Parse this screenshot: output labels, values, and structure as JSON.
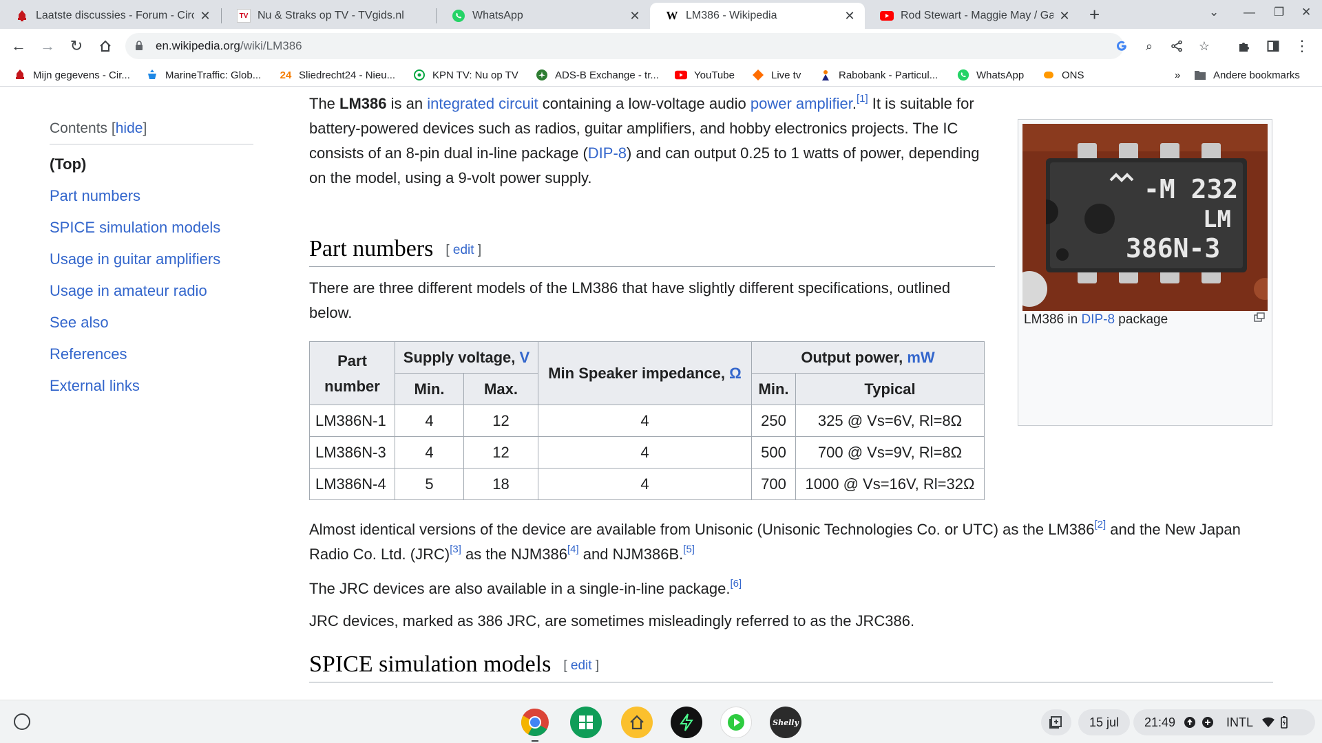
{
  "tabs": [
    {
      "title": "Laatste discussies - Forum - Circ",
      "favicon": "circuits-online-icon"
    },
    {
      "title": "Nu & Straks op TV - TVgids.nl",
      "favicon": "tvgids-icon",
      "favtext": "TV"
    },
    {
      "title": "WhatsApp",
      "favicon": "whatsapp-icon"
    },
    {
      "title": "LM386 - Wikipedia",
      "favicon": "wikipedia-icon",
      "favtext": "W"
    },
    {
      "title": "Rod Stewart - Maggie May / Gasc",
      "favicon": "youtube-icon"
    }
  ],
  "toolbar": {
    "url_host": "en.wikipedia.org",
    "url_path": "/wiki/LM386"
  },
  "bookmarks": [
    {
      "label": "Mijn gegevens - Cir...",
      "icon": "circuits-online-icon"
    },
    {
      "label": "MarineTraffic: Glob...",
      "icon": "marinetraffic-icon"
    },
    {
      "label": "Sliedrecht24 - Nieu...",
      "icon": "sliedrecht24-icon",
      "favtext": "24"
    },
    {
      "label": "KPN TV: Nu op TV",
      "icon": "kpn-icon"
    },
    {
      "label": "ADS-B Exchange - tr...",
      "icon": "adsb-icon"
    },
    {
      "label": "YouTube",
      "icon": "youtube-icon"
    },
    {
      "label": "Live tv",
      "icon": "livetv-icon"
    },
    {
      "label": "Rabobank - Particul...",
      "icon": "rabobank-icon"
    },
    {
      "label": "WhatsApp",
      "icon": "whatsapp-icon"
    },
    {
      "label": "ONS",
      "icon": "ons-icon"
    }
  ],
  "bookmarks_more": "»",
  "other_bookmarks": "Andere bookmarks",
  "toc": {
    "heading": "Contents",
    "hide_open": "[",
    "hide_link": "hide",
    "hide_close": "]",
    "items": [
      "(Top)",
      "Part numbers",
      "SPICE simulation models",
      "Usage in guitar amplifiers",
      "Usage in amateur radio",
      "See also",
      "References",
      "External links"
    ]
  },
  "intro": {
    "t1": "The ",
    "bold": "LM386",
    "t2": " is an ",
    "link1": "integrated circuit",
    "t3": " containing a low-voltage audio ",
    "link2": "power amplifier",
    "t4": ".",
    "ref1": "[1]",
    "t5": " It is suitable for battery-powered devices such as radios, guitar amplifiers, and hobby electronics projects. The IC consists of an 8-pin dual in-line package (",
    "link3": "DIP-8",
    "t6": ") and can output 0.25 to 1 watts of power, depending on the model, using a 9-volt power supply."
  },
  "section1": {
    "heading": "Part numbers",
    "edit_open": "[ ",
    "edit": "edit",
    "edit_close": " ]",
    "text": "There are three different models of the LM386 that have slightly different specifications, outlined below."
  },
  "table": {
    "h_part": "Part number",
    "h_supply": "Supply voltage, ",
    "h_supply_unit": "V",
    "h_imp": "Min Speaker impedance, ",
    "h_imp_unit": "Ω",
    "h_out": "Output power, ",
    "h_out_unit": "mW",
    "h_min": "Min.",
    "h_max": "Max.",
    "h_omin": "Min.",
    "h_typ": "Typical",
    "rows": [
      {
        "part": "LM386N-1",
        "vmin": "4",
        "vmax": "12",
        "imp": "4",
        "pmin": "250",
        "typ": "325 @ Vs=6V, Rl=8Ω"
      },
      {
        "part": "LM386N-3",
        "vmin": "4",
        "vmax": "12",
        "imp": "4",
        "pmin": "500",
        "typ": "700 @ Vs=9V, Rl=8Ω"
      },
      {
        "part": "LM386N-4",
        "vmin": "5",
        "vmax": "18",
        "imp": "4",
        "pmin": "700",
        "typ": "1000 @ Vs=16V, Rl=32Ω"
      }
    ]
  },
  "after_table": {
    "p1_a": "Almost identical versions of the device are available from Unisonic (Unisonic Technologies Co. or UTC) as the LM386",
    "p1_ref2": "[2]",
    "p1_b": " and the New Japan Radio Co. Ltd. (JRC)",
    "p1_ref3": "[3]",
    "p1_c": " as the NJM386",
    "p1_ref4": "[4]",
    "p1_d": " and NJM386B.",
    "p1_ref5": "[5]",
    "p2": "The JRC devices are also available in a single-in-line package.",
    "p2_ref6": "[6]",
    "p3": "JRC devices, marked as 386 JRC, are sometimes misleadingly referred to as the JRC386."
  },
  "section2": {
    "heading": "SPICE simulation models",
    "edit_open": "[ ",
    "edit": "edit",
    "edit_close": " ]"
  },
  "thumb": {
    "chip_line1": "-M 232",
    "chip_line2": "LM",
    "chip_line3": "386N-3",
    "caption_a": "LM386 in ",
    "caption_link": "DIP-8",
    "caption_b": " package"
  },
  "shelf": {
    "apps": [
      "chrome-icon",
      "calculator-icon",
      "home-app-icon",
      "bolt-app-icon",
      "play-app-icon",
      "shelly-icon"
    ],
    "shelly_label": "Shelly",
    "date": "15 jul",
    "time": "21:49",
    "ime": "INTL"
  },
  "colors": {
    "link": "#3366cc",
    "tabstrip": "#dee1e6",
    "table_header": "#eaecf0"
  }
}
